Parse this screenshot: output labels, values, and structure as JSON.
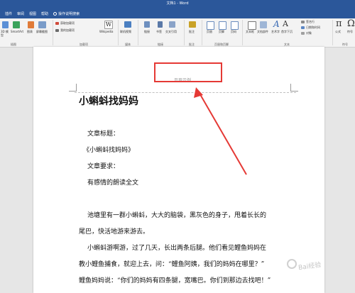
{
  "window": {
    "title": "文档1 - Word"
  },
  "tabs": [
    "插件",
    "审阅",
    "视图",
    "帮助"
  ],
  "tell_me": "操作说明搜索",
  "ribbon": {
    "buttons": {
      "model3d": "3D 模型",
      "smartart": "SmartArt",
      "chart": "图表",
      "screenshot": "屏幕截图",
      "get_addins": "获取加载项",
      "my_addins": "我的加载项",
      "wikipedia": "Wikipedia",
      "online_video": "联机视频",
      "link": "链接",
      "bookmark": "书签",
      "cross_ref": "交叉引用",
      "comment": "批注",
      "header": "页眉",
      "footer": "页脚",
      "page_num": "页码",
      "textbox": "文本框",
      "quickparts": "文档部件",
      "wordart": "艺术字",
      "dropcap": "首字下沉",
      "sigline": "签名行",
      "datetime": "日期和时间",
      "object": "对象",
      "equation": "公式",
      "symbol": "符号"
    },
    "groups": {
      "illustrations": "插图",
      "addins": "加载项",
      "media": "媒体",
      "links": "链接",
      "comments": "批注",
      "header_footer": "页眉和页脚",
      "text": "文本",
      "symbols": "符号"
    }
  },
  "document": {
    "header_placeholder": "页眉示例",
    "title": "小蝌蚪找妈妈",
    "lines": [
      "文章标题：",
      "《小蝌蚪找妈妈》",
      "文章要求：",
      "有感情的朗读全文",
      "池塘里有一群小蝌蚪，大大的脑袋，黑灰色的身子，甩着长长的",
      "尾巴，快活地游来游去。",
      "小蝌蚪游啊游，过了几天，长出两条后腿。他们看见鲤鱼妈妈在",
      "教小鲤鱼捕食，就迎上去，问：“鲤鱼阿姨，我们的妈妈在哪里？”",
      "鲤鱼妈妈说：“你们的妈妈有四条腿，宽嘴巴。你们到那边去找吧！”"
    ]
  },
  "watermark": "Bai经验",
  "colors": {
    "accent": "#2b579a",
    "highlight": "#e53935"
  }
}
